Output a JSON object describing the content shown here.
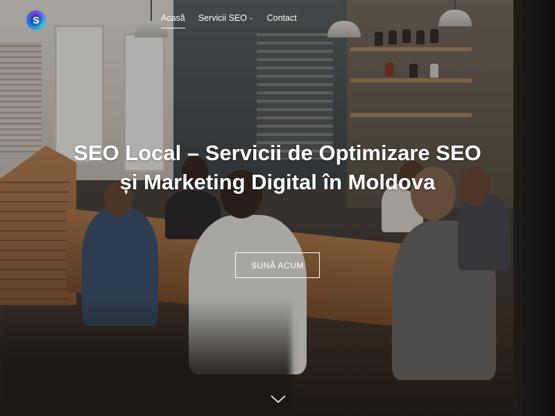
{
  "header": {
    "logo_letter": "S",
    "nav": [
      {
        "label": "Acasă",
        "active": true
      },
      {
        "label": "Servicii SEO",
        "has_dropdown": true
      },
      {
        "label": "Contact"
      }
    ]
  },
  "hero": {
    "title": "SEO Local – Servicii de Optimizare SEO și Marketing Digital în Moldova",
    "cta_label": "SUNĂ ACUM",
    "scroll_icon": "chevron-down-icon"
  },
  "colors": {
    "overlay": "rgba(0,0,0,0.28)",
    "text": "#ffffff",
    "logo_gradient": [
      "#7a3cf0",
      "#2ec5e8",
      "#1e7be0"
    ]
  }
}
